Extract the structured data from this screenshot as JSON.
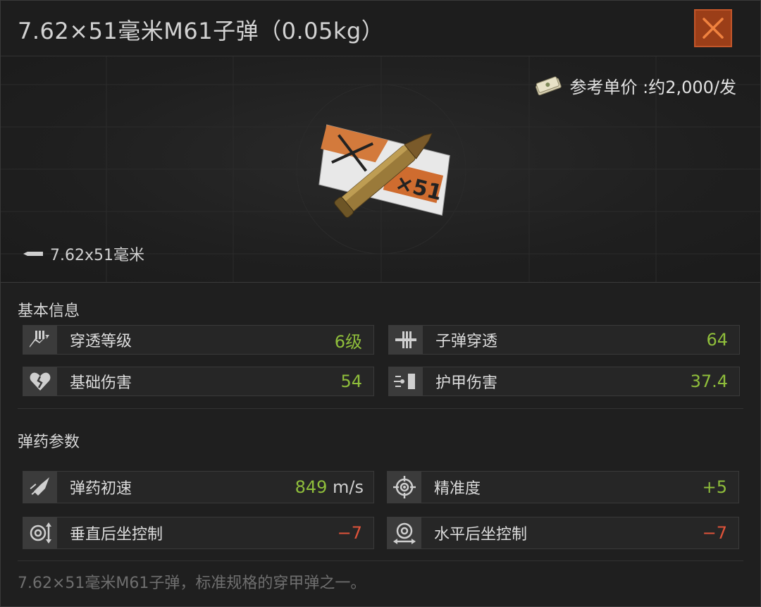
{
  "title": "7.62×51毫米M61子弹（0.05kg）",
  "price": {
    "label": "参考单价 :约2,000/发",
    "icon": "money-stack-icon"
  },
  "caliber": "7.62x51毫米",
  "sections": {
    "basic": {
      "title": "基本信息",
      "stats": [
        {
          "label": "穿透等级",
          "value": "6级",
          "color": "#8fbe3b",
          "icon": "penetration-level-icon"
        },
        {
          "label": "子弹穿透",
          "value": "64",
          "color": "#8fbe3b",
          "icon": "bullet-penetration-icon"
        },
        {
          "label": "基础伤害",
          "value": "54",
          "color": "#8fbe3b",
          "icon": "broken-heart-icon"
        },
        {
          "label": "护甲伤害",
          "value": "37.4",
          "color": "#8fbe3b",
          "icon": "armor-damage-icon"
        }
      ]
    },
    "ammo": {
      "title": "弹药参数",
      "stats": [
        {
          "label": "弹药初速",
          "value": "849",
          "unit": "m/s",
          "color": "#8fbe3b",
          "icon": "muzzle-velocity-icon"
        },
        {
          "label": "精准度",
          "value": "+5",
          "color": "#8fbe3b",
          "icon": "crosshair-icon"
        },
        {
          "label": "垂直后坐控制",
          "value": "−7",
          "color": "#e0533a",
          "icon": "vertical-recoil-icon"
        },
        {
          "label": "水平后坐控制",
          "value": "−7",
          "color": "#e0533a",
          "icon": "horizontal-recoil-icon"
        }
      ]
    }
  },
  "description": "7.62×51毫米M61子弹，标准规格的穿甲弹之一。"
}
